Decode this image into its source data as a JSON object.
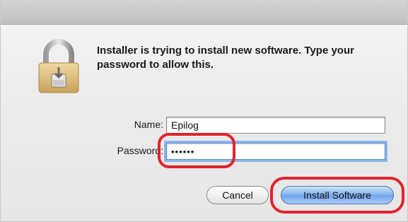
{
  "dialog": {
    "message": "Installer is trying to install new software. Type your password to allow this."
  },
  "fields": {
    "name_label": "Name:",
    "name_value": "Epilog",
    "password_label": "Password:",
    "password_value": "••••••"
  },
  "buttons": {
    "cancel_label": "Cancel",
    "install_label": "Install Software"
  },
  "icons": {
    "lock": "padlock-icon"
  },
  "colors": {
    "highlight": "#e2232a",
    "default_button": "#7fb0ee",
    "focus_ring": "#8fb5ea"
  }
}
